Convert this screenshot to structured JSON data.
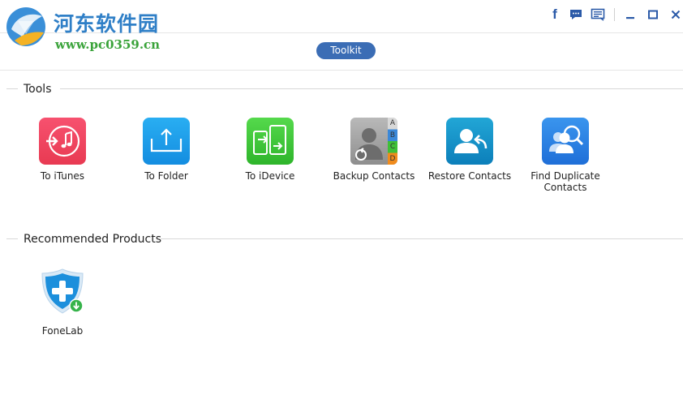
{
  "watermark": {
    "title": "河东软件园",
    "url": "www.pc0359.cn"
  },
  "window_controls": {
    "facebook": "f"
  },
  "toolbar": {
    "toolkit_label": "Toolkit"
  },
  "tools_section": {
    "title": "Tools",
    "items": [
      {
        "label": "To iTunes",
        "icon": "itunes-icon"
      },
      {
        "label": "To Folder",
        "icon": "folder-upload-icon"
      },
      {
        "label": "To iDevice",
        "icon": "device-transfer-icon"
      },
      {
        "label": "Backup Contacts",
        "icon": "contacts-backup-icon",
        "letters": [
          "A",
          "B",
          "C",
          "D"
        ]
      },
      {
        "label": "Restore Contacts",
        "icon": "contacts-restore-icon"
      },
      {
        "label": "Find Duplicate Contacts",
        "icon": "find-duplicate-icon"
      }
    ]
  },
  "recommended_section": {
    "title": "Recommended Products",
    "items": [
      {
        "label": "FoneLab",
        "icon": "fonelab-icon"
      }
    ]
  },
  "colors": {
    "accent": "#3b6db5",
    "itunes": "#ee3f5c",
    "folder": "#1f9be8",
    "idevice": "#3fc23c",
    "contacts_gray": "#9c9c9c",
    "restore": "#1590c6",
    "duplicate": "#2b7fe0"
  }
}
